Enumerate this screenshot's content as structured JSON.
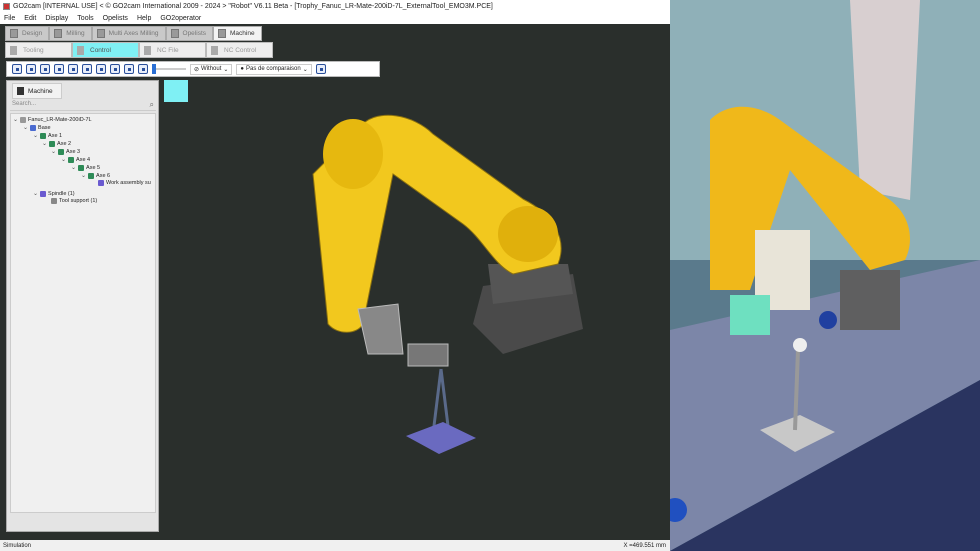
{
  "window": {
    "title": "GO2cam [INTERNAL USE] < © GO2cam International 2009 - 2024 >    \"Robot\"  V6.11 Beta  - [Trophy_Fanuc_LR-Mate-200iD-7L_ExternalTool_EMO3M.PCE]"
  },
  "menu": [
    "File",
    "Edit",
    "Display",
    "Tools",
    "Opelists",
    "Help",
    "GO2operator"
  ],
  "mode_tabs": [
    {
      "label": "Design"
    },
    {
      "label": "Milling"
    },
    {
      "label": "Multi Axes Milling"
    },
    {
      "label": "Opelists"
    },
    {
      "label": "Machine",
      "active": true
    }
  ],
  "sub_tabs": [
    {
      "label": "Tooling"
    },
    {
      "label": "Control",
      "active": true
    },
    {
      "label": "NC File"
    },
    {
      "label": "NC Control"
    }
  ],
  "toolbar": {
    "without": "Without",
    "comparison": "Pas de comparaison"
  },
  "panel": {
    "tab": "Machine",
    "search_placeholder": "Search...",
    "tree": [
      "Fanuc_LR-Mate-200iD-7L",
      "Base",
      "Axe 1",
      "Axe 2",
      "Axe 3",
      "Axe 4",
      "Axe 5",
      "Axe 6",
      "Work assembly su",
      "Spindle (1)",
      "Tool support (1)"
    ]
  },
  "status": {
    "left": "Simulation",
    "coord": "X =469.551 mm"
  },
  "colors": {
    "accent": "#7ff0f4",
    "robot": "#f2c81e",
    "viewport": "#2a2f2c"
  }
}
